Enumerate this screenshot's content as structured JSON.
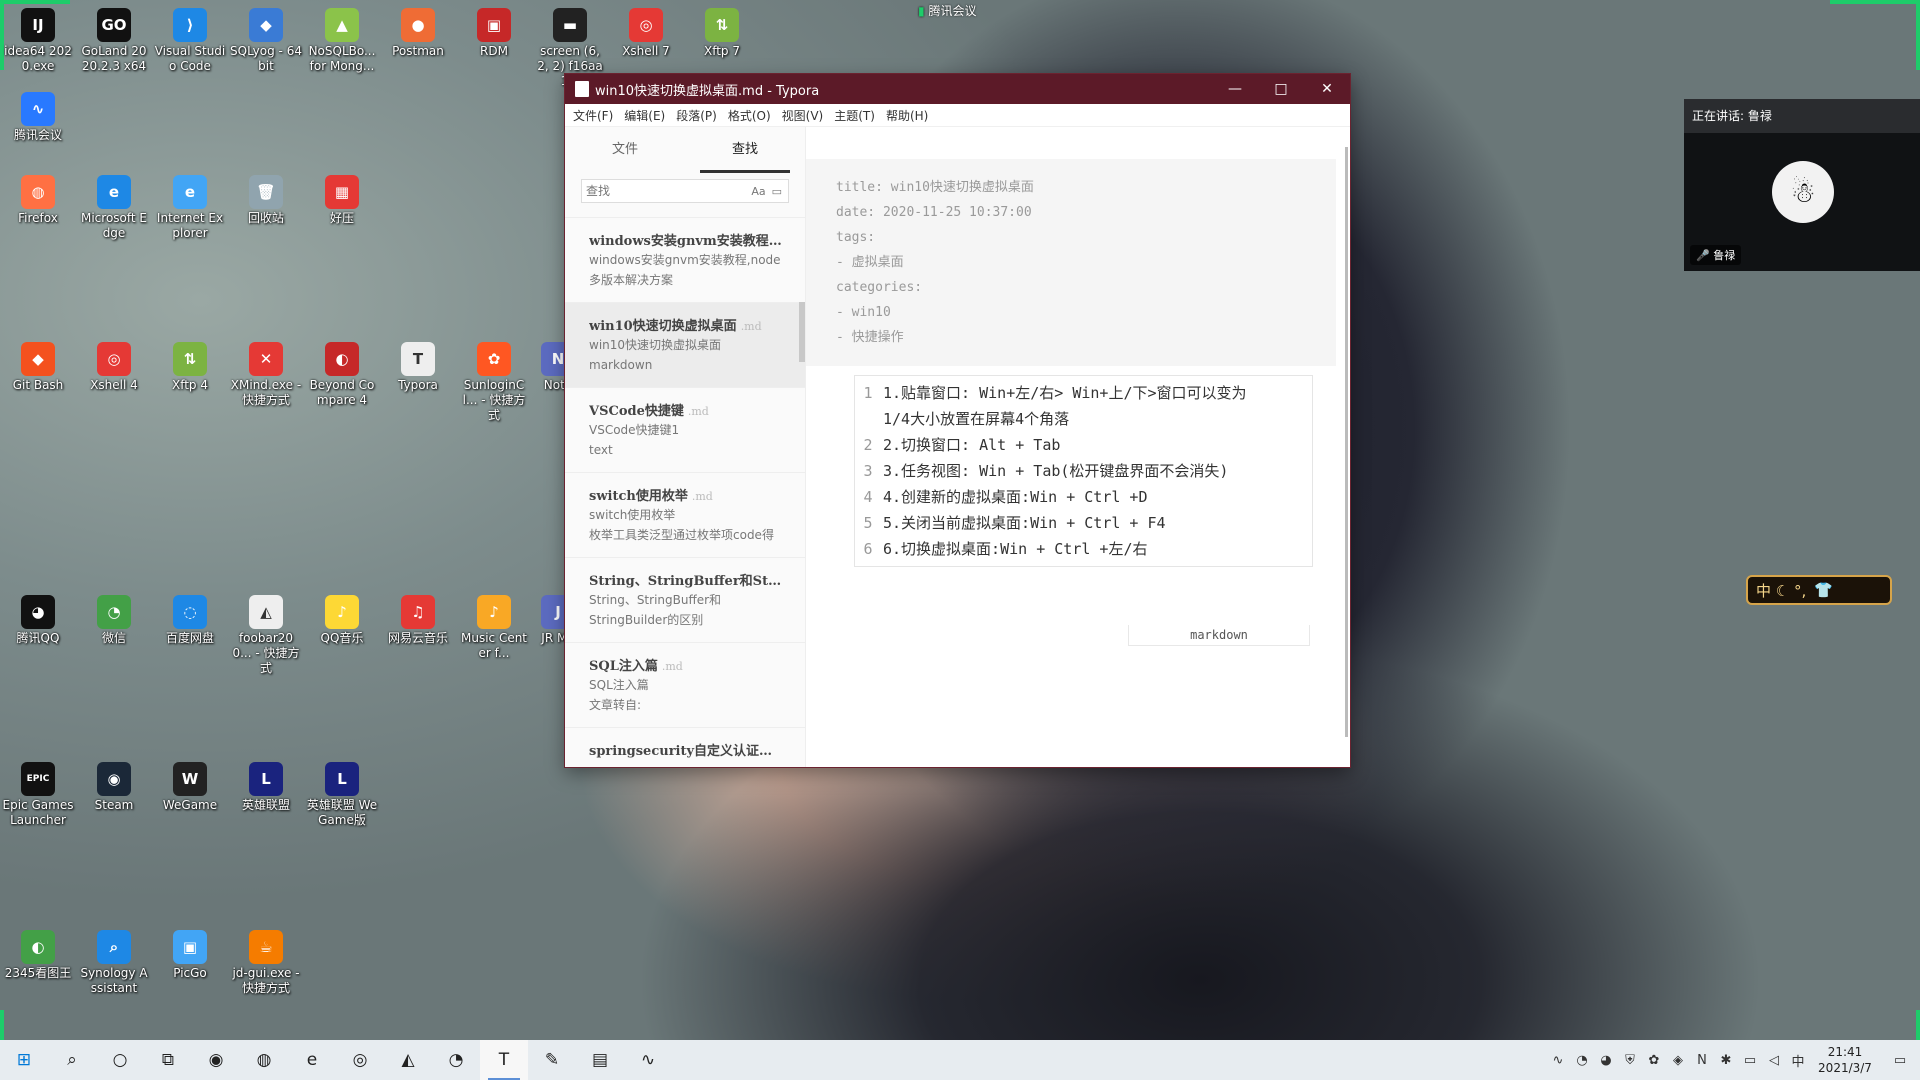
{
  "desktop": {
    "icons": [
      {
        "label": "idea64 2020.exe",
        "glyph": "IJ",
        "color": "#111"
      },
      {
        "label": "GoLand 2020.2.3 x64",
        "glyph": "GO",
        "color": "#111"
      },
      {
        "label": "Visual Studio Code",
        "glyph": "⟩",
        "color": "#1e88e5"
      },
      {
        "label": "SQLyog - 64 bit",
        "glyph": "◆",
        "color": "#3a7bd5"
      },
      {
        "label": "NoSQLBo... for Mong...",
        "glyph": "▲",
        "color": "#8bc34a"
      },
      {
        "label": "Postman",
        "glyph": "●",
        "color": "#ef6c35"
      },
      {
        "label": "RDM",
        "glyph": "▣",
        "color": "#c62828"
      },
      {
        "label": "screen (6, 2, 2) f16aa1...",
        "glyph": "▬",
        "color": "#222"
      },
      {
        "label": "Xshell 7",
        "glyph": "◎",
        "color": "#e53935"
      },
      {
        "label": "Xftp 7",
        "glyph": "⇅",
        "color": "#7cb342"
      },
      {
        "label": "腾讯会议",
        "glyph": "∿",
        "color": "#2979ff"
      },
      {
        "label": "Firefox",
        "glyph": "◍",
        "color": "#ff7043"
      },
      {
        "label": "Microsoft Edge",
        "glyph": "e",
        "color": "#1e88e5"
      },
      {
        "label": "Internet Explorer",
        "glyph": "e",
        "color": "#42a5f5"
      },
      {
        "label": "回收站",
        "glyph": "🗑",
        "color": "#90a4ae"
      },
      {
        "label": "好压",
        "glyph": "▦",
        "color": "#e53935"
      },
      {
        "label": "Git Bash",
        "glyph": "◆",
        "color": "#f4511e"
      },
      {
        "label": "Xshell 4",
        "glyph": "◎",
        "color": "#e53935"
      },
      {
        "label": "Xftp 4",
        "glyph": "⇅",
        "color": "#7cb342"
      },
      {
        "label": "XMind.exe - 快捷方式",
        "glyph": "✕",
        "color": "#e53935"
      },
      {
        "label": "Beyond Compare 4",
        "glyph": "◐",
        "color": "#c62828"
      },
      {
        "label": "Typora",
        "glyph": "T",
        "color": "#eeeeee"
      },
      {
        "label": "SunloginCl... - 快捷方式",
        "glyph": "✿",
        "color": "#ff5722"
      },
      {
        "label": "Note",
        "glyph": "N",
        "color": "#5c6bc0"
      },
      {
        "label": "腾讯QQ",
        "glyph": "◕",
        "color": "#111"
      },
      {
        "label": "微信",
        "glyph": "◔",
        "color": "#43a047"
      },
      {
        "label": "百度网盘",
        "glyph": "◌",
        "color": "#1e88e5"
      },
      {
        "label": "foobar200... - 快捷方式",
        "glyph": "◭",
        "color": "#eeeeee"
      },
      {
        "label": "QQ音乐",
        "glyph": "♪",
        "color": "#fdd835"
      },
      {
        "label": "网易云音乐",
        "glyph": "♫",
        "color": "#e53935"
      },
      {
        "label": "Music Center f...",
        "glyph": "♪",
        "color": "#f9a825"
      },
      {
        "label": "JR Me",
        "glyph": "J",
        "color": "#5c6bc0"
      },
      {
        "label": "Epic Games Launcher",
        "glyph": "EPIC",
        "color": "#111"
      },
      {
        "label": "Steam",
        "glyph": "◉",
        "color": "#1b2838"
      },
      {
        "label": "WeGame",
        "glyph": "W",
        "color": "#222"
      },
      {
        "label": "英雄联盟",
        "glyph": "L",
        "color": "#1a237e"
      },
      {
        "label": "英雄联盟 WeGame版",
        "glyph": "L",
        "color": "#1a237e"
      },
      {
        "label": "2345看图王",
        "glyph": "◐",
        "color": "#43a047"
      },
      {
        "label": "Synology Assistant",
        "glyph": "⌕",
        "color": "#1e88e5"
      },
      {
        "label": "PicGo",
        "glyph": "▣",
        "color": "#42a5f5"
      },
      {
        "label": "jd-gui.exe - 快捷方式",
        "glyph": "☕",
        "color": "#f57c00"
      }
    ]
  },
  "tencent_meeting": {
    "top_label": "腾讯会议",
    "speaking_label": "正在讲话: 鲁禄",
    "speaker_name": "鲁禄"
  },
  "ime": {
    "text": "中 ☾ °,"
  },
  "typora": {
    "title": "win10快速切换虚拟桌面.md - Typora",
    "menu": [
      "文件(F)",
      "编辑(E)",
      "段落(P)",
      "格式(O)",
      "视图(V)",
      "主题(T)",
      "帮助(H)"
    ],
    "sidebar": {
      "tabs": [
        "文件",
        "查找"
      ],
      "search_placeholder": "查找",
      "search_case_option": "Aa",
      "files": [
        {
          "title": "windows安装gnvm安装教程,n...",
          "ext": "",
          "preview1": "windows安装gnvm安装教程,node",
          "preview2": "多版本解决方案"
        },
        {
          "title": "win10快速切换虚拟桌面",
          "ext": ".md",
          "preview1": "win10快速切换虚拟桌面",
          "preview2": "markdown"
        },
        {
          "title": "VSCode快捷键",
          "ext": ".md",
          "preview1": "VSCode快捷键1",
          "preview2": "text"
        },
        {
          "title": "switch使用枚举",
          "ext": ".md",
          "preview1": "switch使用枚举",
          "preview2": "枚举工具类泛型通过枚举项code得"
        },
        {
          "title": "String、StringBuffer和String...",
          "ext": "",
          "preview1": "String、StringBuffer和",
          "preview2": "StringBuilder的区别"
        },
        {
          "title": "SQL注入篇",
          "ext": ".md",
          "preview1": "SQL注入篇",
          "preview2": "文章转自:"
        },
        {
          "title": "springsecurity自定义认证过程",
          "ext": "",
          "preview1": "",
          "preview2": ""
        }
      ]
    },
    "front_matter": [
      "title: win10快速切换虚拟桌面",
      "date: 2020-11-25 10:37:00",
      "tags:",
      "- 虚拟桌面",
      "categories:",
      "- win10",
      "- 快捷操作"
    ],
    "code_lines": [
      {
        "n": "1",
        "text": "1.贴靠窗口: Win+左/右> Win+上/下>窗口可以变为"
      },
      {
        "n": "",
        "text": "1/4大小放置在屏幕4个角落"
      },
      {
        "n": "2",
        "text": "2.切换窗口: Alt + Tab"
      },
      {
        "n": "3",
        "text": "3.任务视图: Win + Tab(松开键盘界面不会消失)"
      },
      {
        "n": "4",
        "text": "4.创建新的虚拟桌面:Win + Ctrl +D"
      },
      {
        "n": "5",
        "text": "5.关闭当前虚拟桌面:Win + Ctrl + F4"
      },
      {
        "n": "6",
        "text": "6.切换虚拟桌面:Win + Ctrl +左/右"
      }
    ],
    "code_lang": "markdown"
  },
  "taskbar": {
    "items": [
      "windows-logo",
      "search",
      "cortana",
      "task-view",
      "chrome",
      "firefox",
      "edge",
      "network-tool",
      "foobar",
      "wechat",
      "typora",
      "notepad",
      "file-explorer",
      "tencent-meeting"
    ],
    "glyphs": [
      "⊞",
      "⌕",
      "○",
      "⧉",
      "◉",
      "◍",
      "e",
      "◎",
      "◭",
      "◔",
      "T",
      "✎",
      "▤",
      "∿"
    ],
    "time": "21:41",
    "date": "2021/3/7"
  }
}
